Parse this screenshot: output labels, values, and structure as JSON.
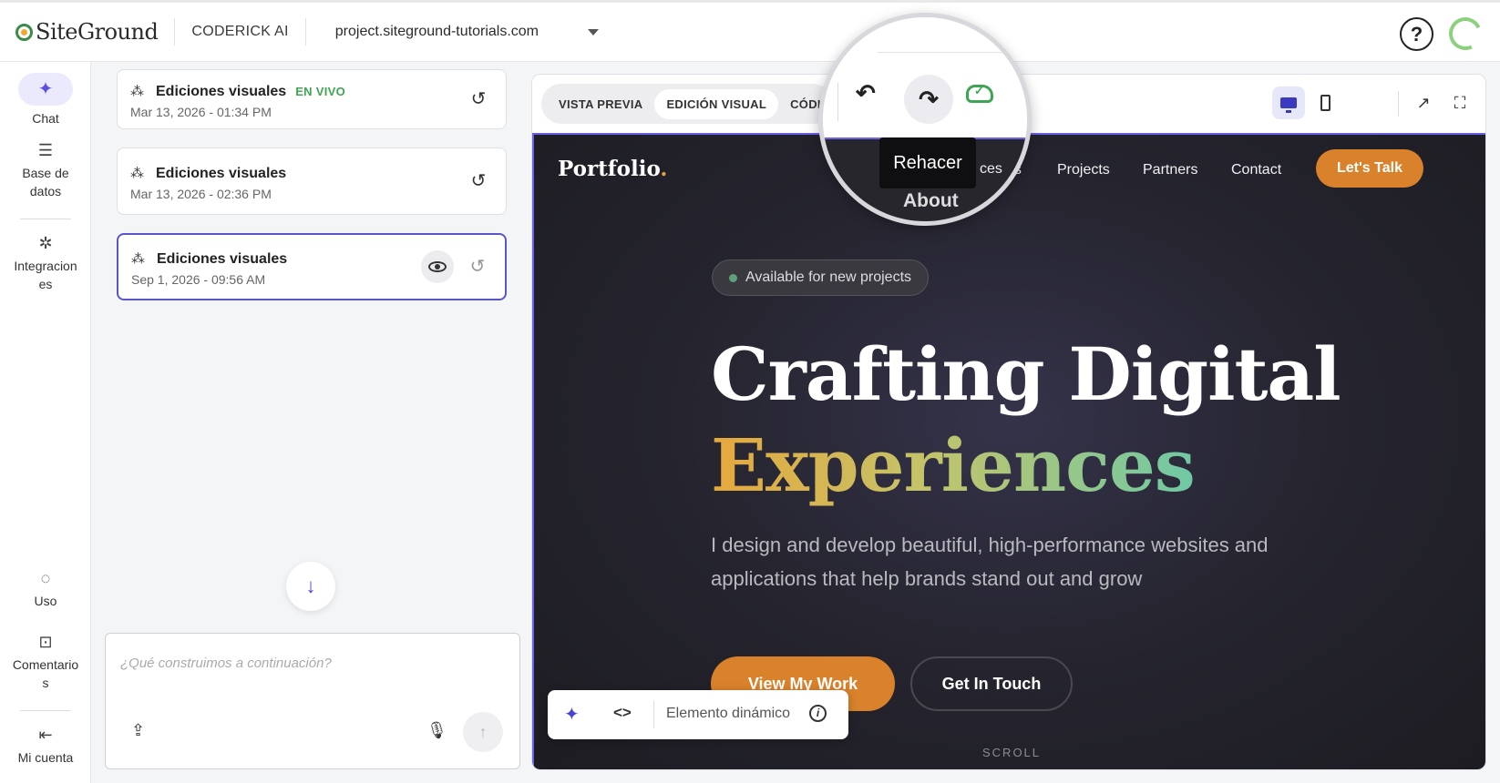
{
  "topbar": {
    "logo": "SiteGround",
    "product": "CODERICK AI",
    "domain": "project.siteground-tutorials.com",
    "help": "?"
  },
  "leftnav": {
    "items": [
      {
        "label": "Chat",
        "icon": "sparkle-icon"
      },
      {
        "label": "Base de datos",
        "icon": "database-icon"
      },
      {
        "label": "Integraciones",
        "icon": "integrations-icon"
      },
      {
        "label": "Uso",
        "icon": "usage-icon"
      },
      {
        "label": "Comentarios",
        "icon": "comment-icon"
      },
      {
        "label": "Mi cuenta",
        "icon": "account-icon"
      }
    ],
    "labels": {
      "chat": "Chat",
      "db1": "Base de",
      "db2": "datos",
      "int1": "Integracion",
      "int2": "es",
      "uso": "Uso",
      "com1": "Comentario",
      "com2": "s",
      "cuenta": "Mi cuenta"
    }
  },
  "history": {
    "cards": [
      {
        "title": "Ediciones visuales",
        "badge": "EN VIVO",
        "date": "Mar 13, 2026 - 01:34 PM"
      },
      {
        "title": "Ediciones visuales",
        "date": "Mar 13, 2026 - 02:36 PM"
      },
      {
        "title": "Ediciones visuales",
        "date": "Sep 1, 2026 - 09:56 AM"
      }
    ]
  },
  "composer": {
    "placeholder": "¿Qué construimos a continuación?"
  },
  "preview": {
    "tabs": [
      "VISTA PREVIA",
      "EDICIÓN VISUAL",
      "CÓDIGO"
    ],
    "active_tab": "EDICIÓN VISUAL",
    "tooltip": "Rehacer",
    "accent": "#6a62e8"
  },
  "site": {
    "logo": "Portfolio",
    "logo_dot": ".",
    "nav": [
      "About",
      "Services",
      "Projects",
      "Partners",
      "Contact"
    ],
    "nav_partial_services": "ces",
    "cta": "Let's Talk",
    "availability": "Available for new projects",
    "hero_line1": "Crafting Digital",
    "hero_line2": "Experiences",
    "subtitle": "I design and develop beautiful, high-performance websites and applications that help brands stand out and grow",
    "primary_button": "View My Work",
    "secondary_button": "Get In Touch",
    "scroll_label": "SCROLL",
    "accent_orange": "#d9822b"
  },
  "element_bar": {
    "label": "Elemento dinámico"
  }
}
